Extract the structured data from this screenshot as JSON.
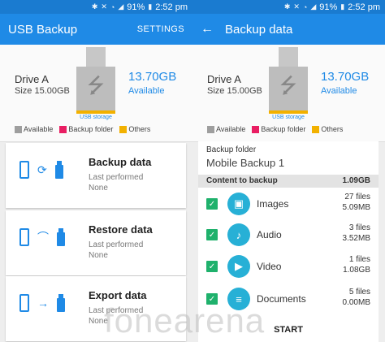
{
  "status": {
    "battery": "91%",
    "time": "2:52 pm"
  },
  "left": {
    "title": "USB Backup",
    "action": "SETTINGS",
    "drive": {
      "name": "Drive A",
      "size": "Size 15.00GB",
      "free": "13.70GB",
      "free_label": "Available",
      "usb_label": "USB storage"
    },
    "legend": [
      {
        "label": "Available",
        "color": "#9e9e9e"
      },
      {
        "label": "Backup folder",
        "color": "#e91e63"
      },
      {
        "label": "Others",
        "color": "#f2b100"
      }
    ],
    "ops": [
      {
        "title": "Backup data",
        "sub": "Last performed",
        "value": "None",
        "mid_icon": "sync-icon"
      },
      {
        "title": "Restore data",
        "sub": "Last performed",
        "value": "None",
        "mid_icon": "restore-icon"
      },
      {
        "title": "Export data",
        "sub": "Last performed",
        "value": "None",
        "mid_icon": "export-icon"
      }
    ]
  },
  "right": {
    "title": "Backup data",
    "drive": {
      "name": "Drive A",
      "size": "Size 15.00GB",
      "free": "13.70GB",
      "free_label": "Available",
      "usb_label": "USB storage"
    },
    "legend": [
      {
        "label": "Available",
        "color": "#9e9e9e"
      },
      {
        "label": "Backup folder",
        "color": "#e91e63"
      },
      {
        "label": "Others",
        "color": "#f2b100"
      }
    ],
    "folder_label": "Backup folder",
    "folder_value": "Mobile Backup 1",
    "content_label": "Content to backup",
    "content_total": "1.09GB",
    "items": [
      {
        "name": "Images",
        "files": "27 files",
        "size": "5.09MB",
        "icon": "image-icon"
      },
      {
        "name": "Audio",
        "files": "3 files",
        "size": "3.52MB",
        "icon": "music-note-icon"
      },
      {
        "name": "Video",
        "files": "1 files",
        "size": "1.08GB",
        "icon": "video-icon"
      },
      {
        "name": "Documents",
        "files": "5 files",
        "size": "0.00MB",
        "icon": "document-icon"
      }
    ],
    "start_label": "START"
  },
  "watermark": "fonearena",
  "colors": {
    "accent": "#1f8ae6",
    "statusbar": "#1a7bd0",
    "check": "#1fb16c",
    "item_icon": "#27b0d6"
  }
}
